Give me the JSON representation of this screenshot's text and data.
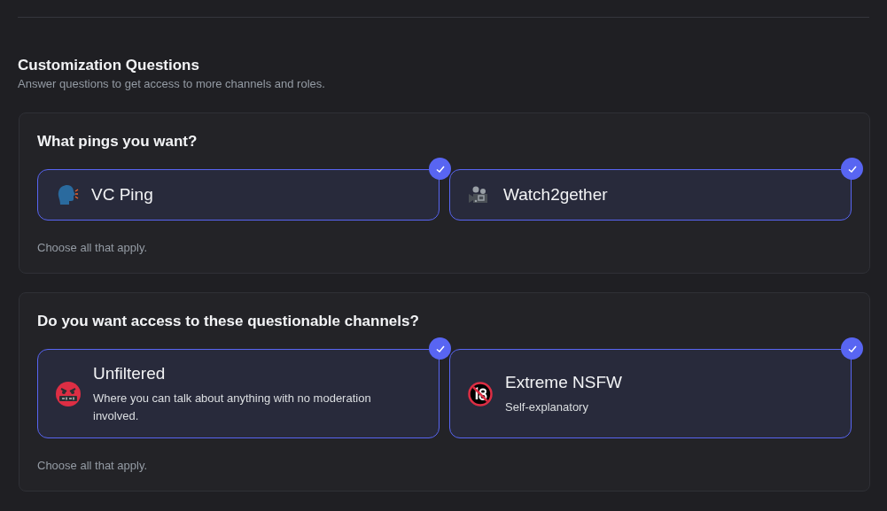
{
  "section": {
    "title": "Customization Questions",
    "subtitle": "Answer questions to get access to more channels and roles."
  },
  "questions": [
    {
      "title": "What pings you want?",
      "hint": "Choose all that apply.",
      "options": [
        {
          "label": "VC Ping",
          "selected": true
        },
        {
          "label": "Watch2gether",
          "selected": true
        }
      ]
    },
    {
      "title": "Do you want access to these questionable channels?",
      "hint": "Choose all that apply.",
      "options": [
        {
          "label": "Unfiltered",
          "description": "Where you can talk about anything with no moderation involved.",
          "selected": true
        },
        {
          "label": "Extreme NSFW",
          "description": "Self-explanatory",
          "selected": true
        }
      ]
    }
  ]
}
